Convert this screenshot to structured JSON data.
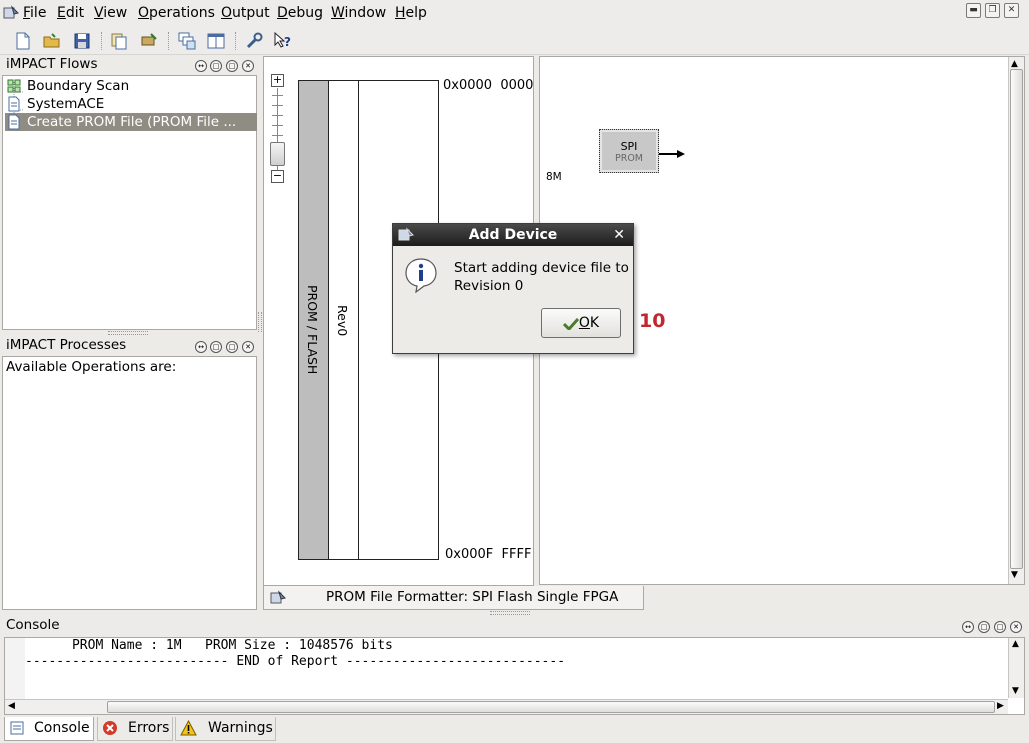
{
  "menubar": {
    "items": [
      {
        "label": "File",
        "underline": "F",
        "rest": "ile"
      },
      {
        "label": "Edit",
        "underline": "E",
        "rest": "dit"
      },
      {
        "label": "View",
        "underline": "V",
        "rest": "iew"
      },
      {
        "label": "Operations",
        "underline": "O",
        "rest": "perations"
      },
      {
        "label": "Output",
        "underline": "O",
        "rest": "utput"
      },
      {
        "label": "Debug",
        "underline": "D",
        "rest": "ebug"
      },
      {
        "label": "Window",
        "underline": "W",
        "rest": "indow"
      },
      {
        "label": "Help",
        "underline": "H",
        "rest": "elp"
      }
    ]
  },
  "flows_panel": {
    "title": "iMPACT Flows",
    "items": [
      "Boundary Scan",
      "SystemACE",
      "Create PROM File (PROM File ..."
    ]
  },
  "processes_panel": {
    "title": "iMPACT Processes",
    "text": "Available Operations are:"
  },
  "prom_diagram": {
    "start_address": "0x0000  0000",
    "end_address": "0x000F  FFFF",
    "device_label": "PROM / FLASH",
    "revision_label": "Rev0",
    "size_label": "8M",
    "chip_title": "SPI",
    "chip_subtitle": "PROM"
  },
  "formatter_tab": {
    "label": "PROM File Formatter: SPI Flash Single FPGA"
  },
  "dialog": {
    "title": "Add Device",
    "message_line1": "Start adding device file to",
    "message_line2": "Revision 0",
    "ok_underline": "O",
    "ok_rest": "K"
  },
  "step_marker": "10",
  "console": {
    "title": "Console",
    "lines": [
      "      PROM Name : 1M   PROM Size : 1048576 bits",
      "-------------------------- END of Report ----------------------------"
    ],
    "tabs": [
      "Console",
      "Errors",
      "Warnings"
    ]
  },
  "colors": {
    "step_marker": "#c0282d",
    "selection": "#8f8c83",
    "dialog_title_bg": "#2b2b2b"
  }
}
